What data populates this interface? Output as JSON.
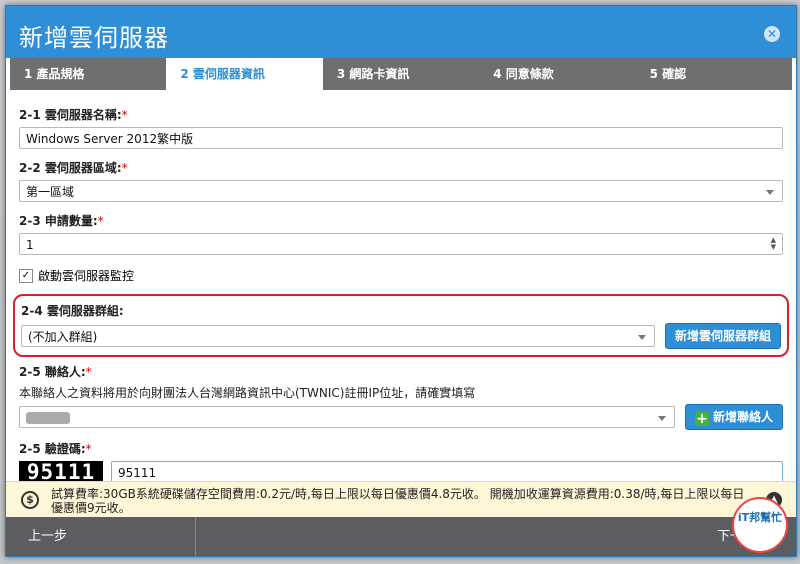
{
  "dialog": {
    "title": "新增雲伺服器",
    "close_icon": "close-icon"
  },
  "steps": [
    {
      "label": "1 產品規格"
    },
    {
      "label": "2 雲伺服器資訊"
    },
    {
      "label": "3 網路卡資訊"
    },
    {
      "label": "4 同意條款"
    },
    {
      "label": "5 確認"
    }
  ],
  "active_step": 2,
  "form": {
    "name": {
      "label": "2-1 雲伺服器名稱:",
      "required": "*",
      "value": "Windows Server 2012繁中版"
    },
    "region": {
      "label": "2-2 雲伺服器區域:",
      "required": "*",
      "value": "第一區域"
    },
    "quantity": {
      "label": "2-3 申請數量:",
      "required": "*",
      "value": "1"
    },
    "monitor": {
      "label": "啟動雲伺服器監控",
      "checked": true
    },
    "group": {
      "label": "2-4 雲伺服器群組:",
      "value": "(不加入群組)",
      "add_button": "新增雲伺服器群組"
    },
    "contact": {
      "label": "2-5 聯絡人:",
      "required": "*",
      "note": "本聯絡人之資料將用於向財團法人台灣網路資訊中心(TWNIC)註冊IP位址，請確實填寫",
      "add_button": "新增聯絡人"
    },
    "captcha": {
      "label": "2-5 驗證碼:",
      "required": "*",
      "image_text": "95111",
      "value": "95111"
    }
  },
  "info": {
    "text": "試算費率:30GB系統硬碟儲存空間費用:0.2元/時,每日上限以每日優惠價4.8元收。 開機加收運算資源費用:0.38/時,每日上限以每日優惠價9元收。"
  },
  "footer": {
    "prev": "上一步",
    "next": "下一步"
  },
  "watermark": {
    "text": "iT邦幫忙"
  },
  "colors": {
    "accent": "#2e8fd6",
    "highlight": "#d3212c",
    "tab_inactive": "#6d6f71"
  }
}
